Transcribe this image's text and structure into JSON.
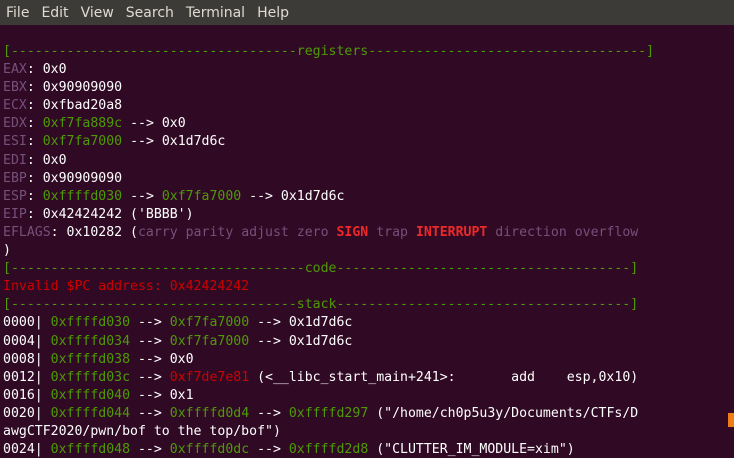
{
  "menu": [
    "File",
    "Edit",
    "View",
    "Search",
    "Terminal",
    "Help"
  ],
  "lines": [
    [
      {
        "t": "[------------------------------------registers-----------------------------------]",
        "c": "g"
      }
    ],
    [
      {
        "t": "EAX",
        "c": "p"
      },
      {
        "t": ": 0x0",
        "c": "w"
      }
    ],
    [
      {
        "t": "EBX",
        "c": "p"
      },
      {
        "t": ": 0x90909090",
        "c": "w"
      }
    ],
    [
      {
        "t": "ECX",
        "c": "p"
      },
      {
        "t": ": 0xfbad20a8",
        "c": "w"
      }
    ],
    [
      {
        "t": "EDX",
        "c": "p"
      },
      {
        "t": ": ",
        "c": "w"
      },
      {
        "t": "0xf7fa889c",
        "c": "g"
      },
      {
        "t": " --> 0x0",
        "c": "w"
      }
    ],
    [
      {
        "t": "ESI",
        "c": "p"
      },
      {
        "t": ": ",
        "c": "w"
      },
      {
        "t": "0xf7fa7000",
        "c": "g"
      },
      {
        "t": " --> 0x1d7d6c",
        "c": "w"
      }
    ],
    [
      {
        "t": "EDI",
        "c": "p"
      },
      {
        "t": ": 0x0",
        "c": "w"
      }
    ],
    [
      {
        "t": "EBP",
        "c": "p"
      },
      {
        "t": ": 0x90909090",
        "c": "w"
      }
    ],
    [
      {
        "t": "ESP",
        "c": "p"
      },
      {
        "t": ": ",
        "c": "w"
      },
      {
        "t": "0xffffd030",
        "c": "g"
      },
      {
        "t": " --> ",
        "c": "w"
      },
      {
        "t": "0xf7fa7000",
        "c": "g"
      },
      {
        "t": " --> 0x1d7d6c",
        "c": "w"
      }
    ],
    [
      {
        "t": "EIP",
        "c": "p"
      },
      {
        "t": ": 0x42424242 ('BBBB')",
        "c": "w"
      }
    ],
    [
      {
        "t": "EFLAGS",
        "c": "p"
      },
      {
        "t": ": 0x10282 (",
        "c": "w"
      },
      {
        "t": "carry parity adjust zero ",
        "c": "p"
      },
      {
        "t": "SIGN",
        "c": "r"
      },
      {
        "t": " trap ",
        "c": "p"
      },
      {
        "t": "INTERRUPT",
        "c": "r"
      },
      {
        "t": " direction overflow",
        "c": "p"
      }
    ],
    [
      {
        "t": ")",
        "c": "w"
      }
    ],
    [
      {
        "t": "[-------------------------------------code-------------------------------------]",
        "c": "g"
      }
    ],
    [
      {
        "t": "Invalid $PC address: 0x42424242",
        "c": "rn"
      }
    ],
    [
      {
        "t": "[------------------------------------stack-------------------------------------]",
        "c": "g"
      }
    ],
    [
      {
        "t": "0000| ",
        "c": "w"
      },
      {
        "t": "0xffffd030",
        "c": "g"
      },
      {
        "t": " --> ",
        "c": "w"
      },
      {
        "t": "0xf7fa7000",
        "c": "g"
      },
      {
        "t": " --> 0x1d7d6c",
        "c": "w"
      }
    ],
    [
      {
        "t": "0004| ",
        "c": "w"
      },
      {
        "t": "0xffffd034",
        "c": "g"
      },
      {
        "t": " --> ",
        "c": "w"
      },
      {
        "t": "0xf7fa7000",
        "c": "g"
      },
      {
        "t": " --> 0x1d7d6c",
        "c": "w"
      }
    ],
    [
      {
        "t": "0008| ",
        "c": "w"
      },
      {
        "t": "0xffffd038",
        "c": "g"
      },
      {
        "t": " --> 0x0",
        "c": "w"
      }
    ],
    [
      {
        "t": "0012| ",
        "c": "w"
      },
      {
        "t": "0xffffd03c",
        "c": "g"
      },
      {
        "t": " --> ",
        "c": "w"
      },
      {
        "t": "0xf7de7e81",
        "c": "rn"
      },
      {
        "t": " (<__libc_start_main+241>:\tadd    esp,0x10)",
        "c": "w"
      }
    ],
    [
      {
        "t": "0016| ",
        "c": "w"
      },
      {
        "t": "0xffffd040",
        "c": "g"
      },
      {
        "t": " --> 0x1",
        "c": "w"
      }
    ],
    [
      {
        "t": "0020| ",
        "c": "w"
      },
      {
        "t": "0xffffd044",
        "c": "g"
      },
      {
        "t": " --> ",
        "c": "w"
      },
      {
        "t": "0xffffd0d4",
        "c": "g"
      },
      {
        "t": " --> ",
        "c": "w"
      },
      {
        "t": "0xffffd297",
        "c": "g"
      },
      {
        "t": " (\"/home/ch0p5u3y/Documents/CTFs/D",
        "c": "w"
      }
    ],
    [
      {
        "t": "awgCTF2020/pwn/bof to the top/bof\")",
        "c": "w"
      }
    ],
    [
      {
        "t": "0024| ",
        "c": "w"
      },
      {
        "t": "0xffffd048",
        "c": "g"
      },
      {
        "t": " --> ",
        "c": "w"
      },
      {
        "t": "0xffffd0dc",
        "c": "g"
      },
      {
        "t": " --> ",
        "c": "w"
      },
      {
        "t": "0xffffd2d8",
        "c": "g"
      },
      {
        "t": " (\"CLUTTER_IM_MODULE=xim\")",
        "c": "w"
      }
    ]
  ]
}
